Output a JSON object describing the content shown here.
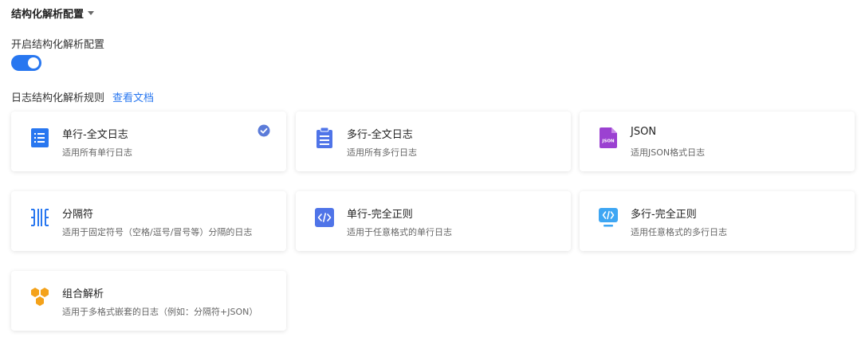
{
  "section": {
    "title": "结构化解析配置"
  },
  "toggle": {
    "label": "开启结构化解析配置",
    "on": true
  },
  "rules": {
    "label": "日志结构化解析规则",
    "doc_link": "查看文档"
  },
  "colors": {
    "accent": "#2877f0",
    "check": "#5b7bd9",
    "json_purple": "#9b41d1",
    "combo_orange": "#f4a21a",
    "sky_blue": "#3ea6f3"
  },
  "cards": [
    {
      "title": "单行-全文日志",
      "desc": "适用所有单行日志",
      "icon": "single-line-log-icon",
      "selected": true
    },
    {
      "title": "多行-全文日志",
      "desc": "适用所有多行日志",
      "icon": "multi-line-log-icon",
      "selected": false
    },
    {
      "title": "JSON",
      "desc": "适用JSON格式日志",
      "icon": "json-file-icon",
      "icon_text": "JSON",
      "selected": false
    },
    {
      "title": "分隔符",
      "desc": "适用于固定符号（空格/逗号/冒号等）分隔的日志",
      "icon": "separator-icon",
      "selected": false
    },
    {
      "title": "单行-完全正则",
      "desc": "适用于任意格式的单行日志",
      "icon": "code-icon",
      "selected": false
    },
    {
      "title": "多行-完全正则",
      "desc": "适用任意格式的多行日志",
      "icon": "code-monitor-icon",
      "selected": false
    },
    {
      "title": "组合解析",
      "desc": "适用于多格式嵌套的日志（例如：分隔符+JSON）",
      "icon": "hexagon-combo-icon",
      "selected": false
    }
  ]
}
